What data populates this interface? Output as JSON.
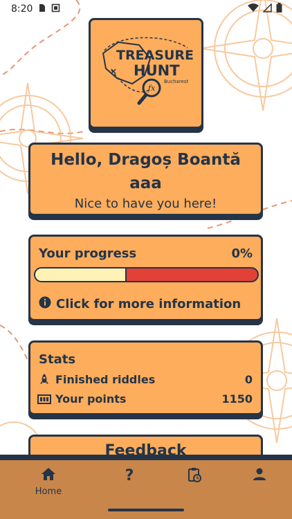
{
  "status_bar": {
    "time": "8:20"
  },
  "logo": {
    "line1": "TREASURE",
    "line2": "HUNT",
    "city": "Bucharest"
  },
  "greeting": {
    "name": "Hello, Dragoș Boantă",
    "username": "aaa",
    "subtitle": "Nice to have you here!"
  },
  "progress": {
    "title": "Your progress",
    "percent_text": "0%",
    "fill_fraction": 0.41,
    "info": "Click for more information"
  },
  "stats": {
    "title": "Stats",
    "items": [
      {
        "label": "Finished riddles",
        "value": "0",
        "icon": "rocket-icon"
      },
      {
        "label": "Your points",
        "value": "1150",
        "icon": "counter-icon"
      }
    ]
  },
  "feedback": {
    "label": "Feedback"
  },
  "nav": {
    "items": [
      {
        "label": "Home",
        "icon": "home-icon"
      },
      {
        "label": "",
        "icon": "help-icon"
      },
      {
        "label": "",
        "icon": "clipboard-clock-icon"
      },
      {
        "label": "",
        "icon": "person-icon"
      }
    ]
  },
  "colors": {
    "card": "#FDAD5C",
    "outline": "#253447",
    "bar_fill": "#FFF2B5",
    "bar_empty": "#e14137",
    "nav": "#C8864A"
  }
}
